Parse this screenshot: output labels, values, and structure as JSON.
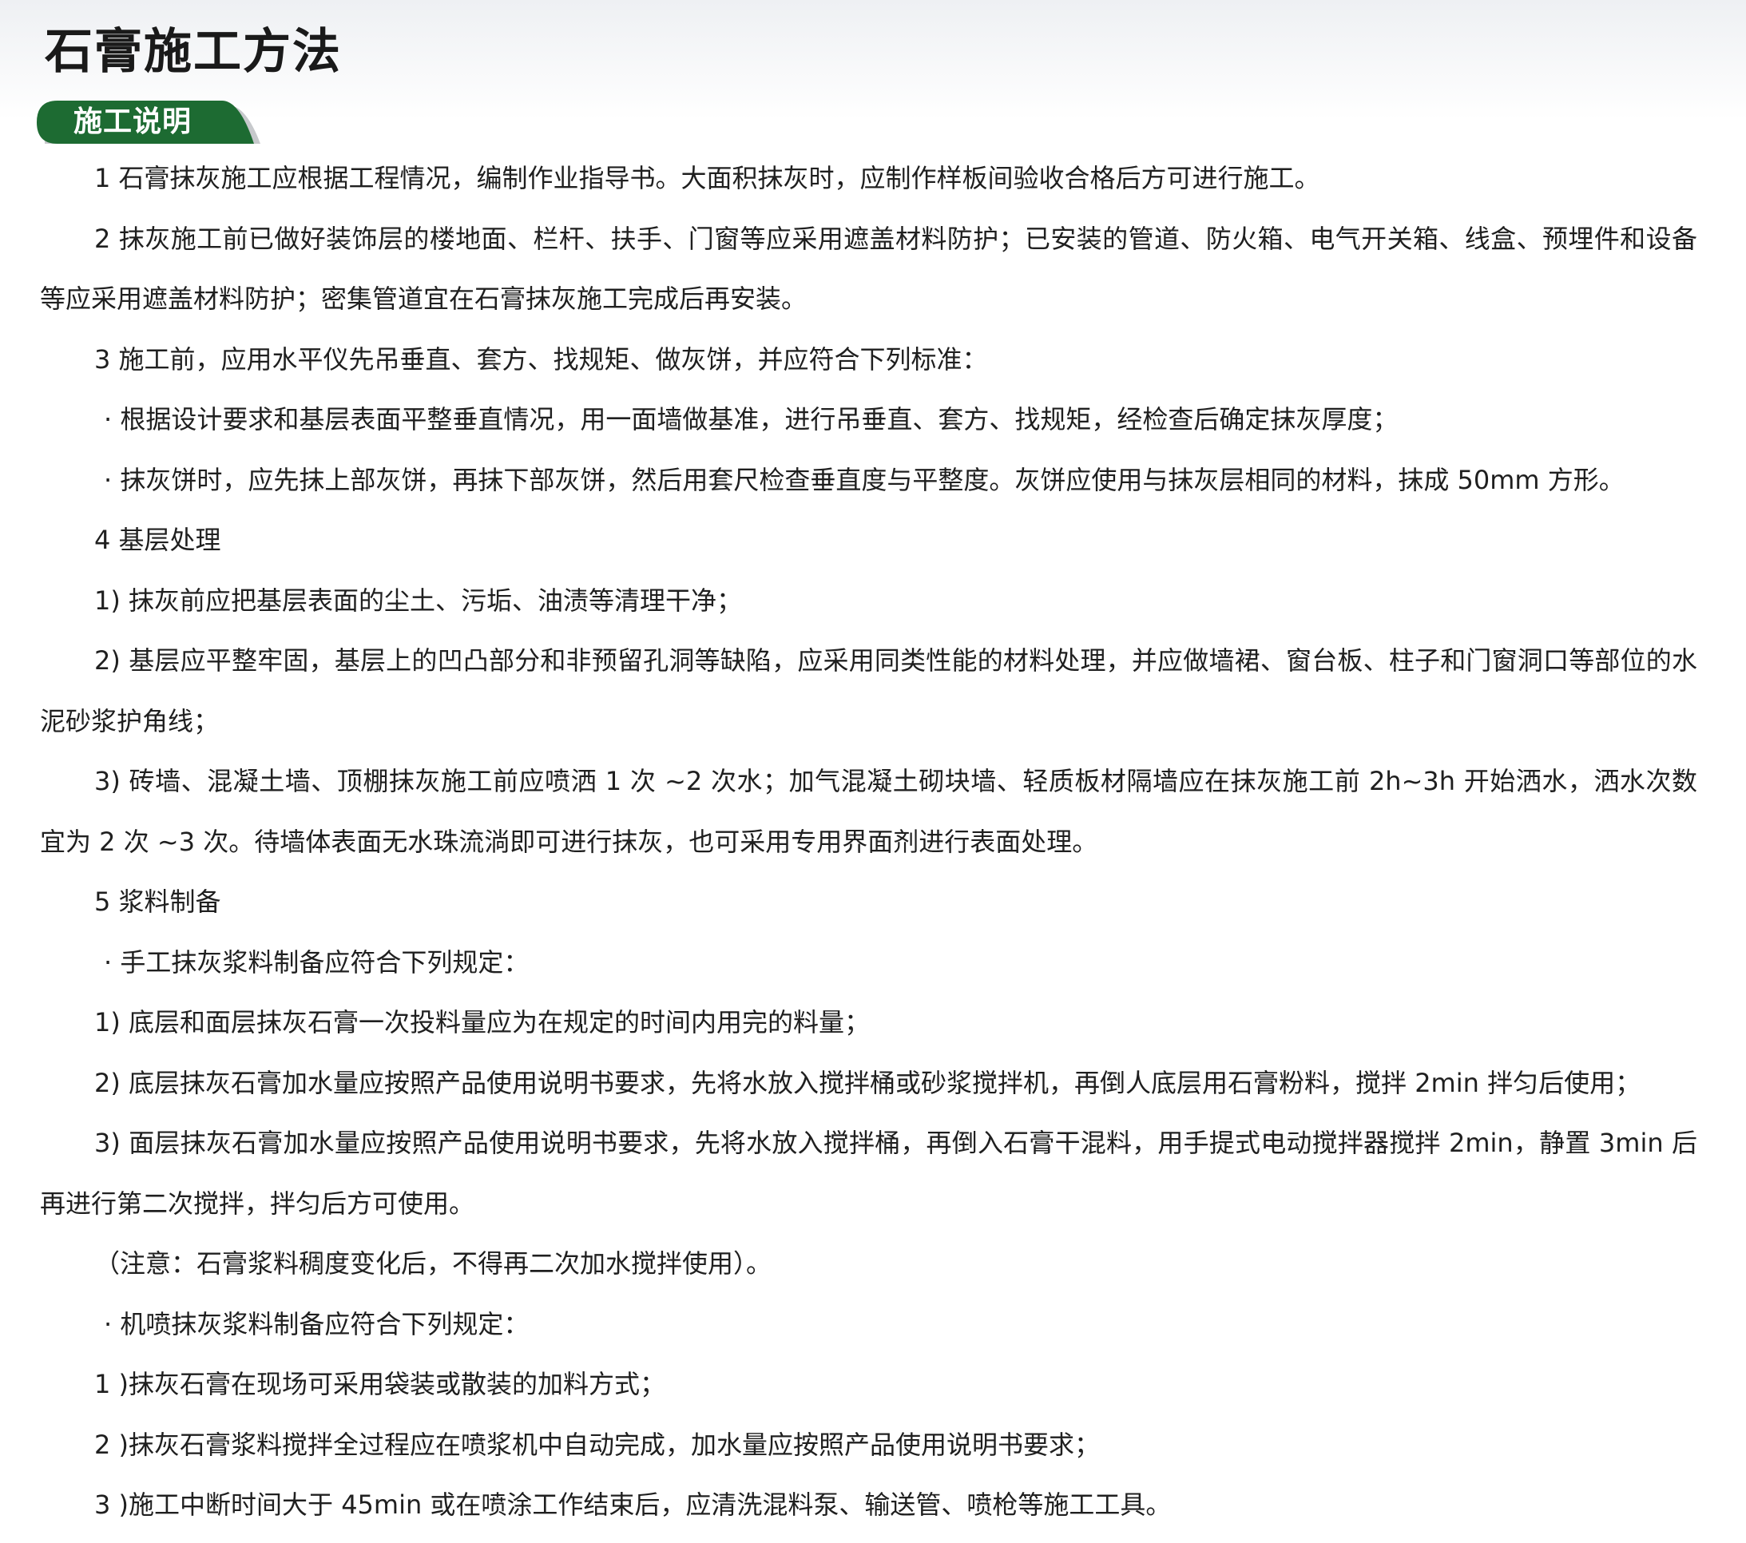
{
  "page": {
    "title": "石膏施工方法",
    "section_label": "施工说明",
    "accent_color": "#1d6b32",
    "tab_shadow_color": "#c7c9cc"
  },
  "paragraphs": [
    {
      "style": "indent",
      "text": "1 石膏抹灰施工应根据工程情况，编制作业指导书。大面积抹灰时，应制作样板间验收合格后方可进行施工。"
    },
    {
      "style": "indent",
      "text": "2 抹灰施工前已做好装饰层的楼地面、栏杆、扶手、门窗等应采用遮盖材料防护；已安装的管道、防火箱、电气开关箱、线盒、预埋件和设备等应采用遮盖材料防护；密集管道宜在石膏抹灰施工完成后再安装。"
    },
    {
      "style": "indent",
      "text": "3 施工前，应用水平仪先吊垂直、套方、找规矩、做灰饼，并应符合下列标准："
    },
    {
      "style": "bullet",
      "text": "· 根据设计要求和基层表面平整垂直情况，用一面墙做基准，进行吊垂直、套方、找规矩，经检查后确定抹灰厚度；"
    },
    {
      "style": "bullet",
      "text": "· 抹灰饼时，应先抹上部灰饼，再抹下部灰饼，然后用套尺检查垂直度与平整度。灰饼应使用与抹灰层相同的材料，抹成 50mm 方形。"
    },
    {
      "style": "indent",
      "text": "4 基层处理"
    },
    {
      "style": "indent",
      "text": "1) 抹灰前应把基层表面的尘土、污垢、油渍等清理干净；"
    },
    {
      "style": "indent",
      "text": "2) 基层应平整牢固，基层上的凹凸部分和非预留孔洞等缺陷，应采用同类性能的材料处理，并应做墙裙、窗台板、柱子和门窗洞口等部位的水泥砂浆护角线；"
    },
    {
      "style": "indent",
      "text": "3) 砖墙、混凝土墙、顶棚抹灰施工前应喷洒 1 次 ~2 次水；加气混凝土砌块墙、轻质板材隔墙应在抹灰施工前 2h~3h 开始洒水，洒水次数宜为 2 次 ~3 次。待墙体表面无水珠流淌即可进行抹灰，也可采用专用界面剂进行表面处理。"
    },
    {
      "style": "indent",
      "text": "5 浆料制备"
    },
    {
      "style": "bullet",
      "text": "· 手工抹灰浆料制备应符合下列规定："
    },
    {
      "style": "indent",
      "text": "1) 底层和面层抹灰石膏一次投料量应为在规定的时间内用完的料量；"
    },
    {
      "style": "indent",
      "text": "2) 底层抹灰石膏加水量应按照产品使用说明书要求，先将水放入搅拌桶或砂浆搅拌机，再倒人底层用石膏粉料，搅拌 2min 拌匀后使用；"
    },
    {
      "style": "indent",
      "text": "3) 面层抹灰石膏加水量应按照产品使用说明书要求，先将水放入搅拌桶，再倒入石膏干混料，用手提式电动搅拌器搅拌 2min，静置 3min 后再进行第二次搅拌，拌匀后方可使用。"
    },
    {
      "style": "indent",
      "text": "（注意：石膏浆料稠度变化后，不得再二次加水搅拌使用）。"
    },
    {
      "style": "bullet",
      "text": "· 机喷抹灰浆料制备应符合下列规定："
    },
    {
      "style": "indent",
      "text": "1 )抹灰石膏在现场可采用袋装或散装的加料方式；"
    },
    {
      "style": "indent",
      "text": "2 )抹灰石膏浆料搅拌全过程应在喷浆机中自动完成，加水量应按照产品使用说明书要求；"
    },
    {
      "style": "indent",
      "text": "3 )施工中断时间大于 45min 或在喷涂工作结束后，应清洗混料泵、输送管、喷枪等施工工具。"
    }
  ]
}
